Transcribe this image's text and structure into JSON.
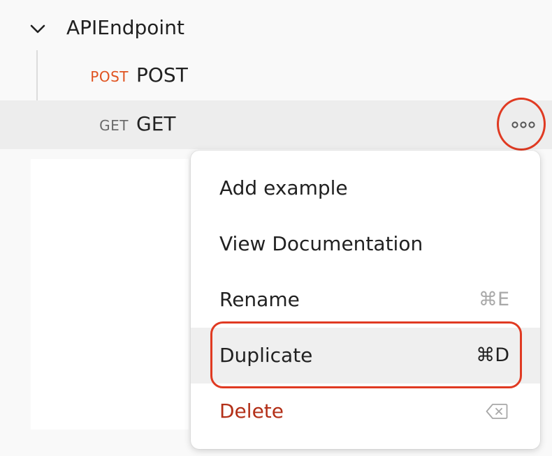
{
  "collection": {
    "folder_name": "APIEndpoint",
    "chevron_icon": "chevron-down-icon"
  },
  "requests": [
    {
      "method": "POST",
      "name": "POST",
      "method_color": "#e05320"
    },
    {
      "method": "GET",
      "name": "GET",
      "method_color": "#6b6b6b"
    }
  ],
  "more_actions": {
    "icon": "more-horizontal-icon",
    "label": "ooo",
    "highlight_color": "#e03a22"
  },
  "context_menu": {
    "items": [
      {
        "label": "Add example",
        "shortcut": ""
      },
      {
        "label": "View Documentation",
        "shortcut": ""
      },
      {
        "label": "Rename",
        "shortcut": "⌘E"
      },
      {
        "label": "Duplicate",
        "shortcut": "⌘D"
      },
      {
        "label": "Delete",
        "shortcut_icon": "backspace-icon"
      }
    ],
    "danger_color": "#b33018"
  }
}
